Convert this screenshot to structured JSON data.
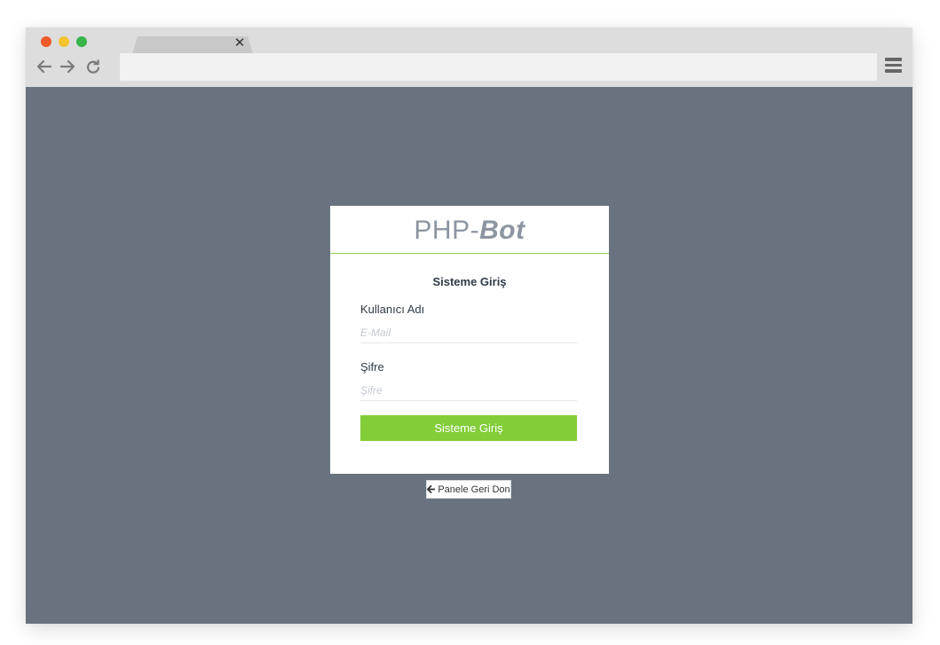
{
  "browser": {
    "tab": {
      "close_glyph": "✕"
    },
    "window_controls": [
      "close",
      "minimize",
      "maximize"
    ],
    "colors": {
      "red": "#f05a28",
      "yellow": "#f5c32c",
      "green": "#37b44a"
    },
    "nav_icons": [
      "arrow-left-icon",
      "arrow-right-icon",
      "reload-icon"
    ],
    "menu_icon": "hamburger-menu-icon",
    "address": ""
  },
  "page": {
    "background": "#68737f",
    "logo": {
      "prefix": "PHP-",
      "suffix": "Bot"
    },
    "form": {
      "title": "Sisteme Giriş",
      "username_label": "Kullanıcı Adı",
      "username_placeholder": "E-Mail",
      "username_value": "",
      "password_label": "Şifre",
      "password_placeholder": "Şifre",
      "password_value": "",
      "submit_label": "Sisteme Giriş",
      "accent": "#82cd38"
    },
    "back_link": {
      "icon": "arrow-left-icon",
      "label": "Panele Geri Don"
    }
  }
}
